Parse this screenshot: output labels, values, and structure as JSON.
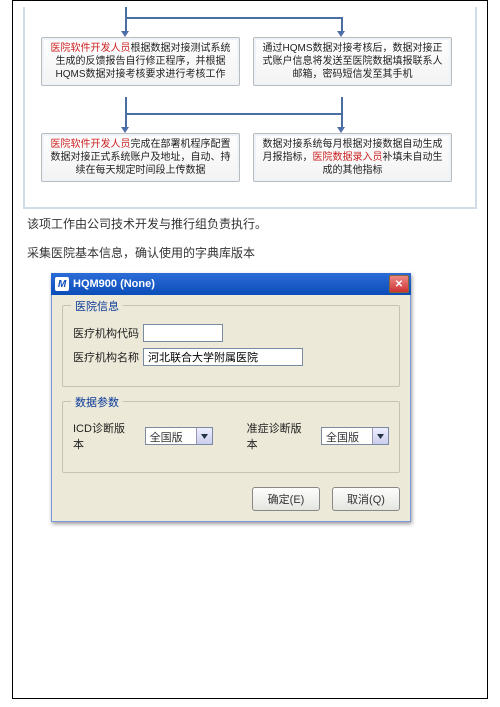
{
  "flow": {
    "box_top_left": {
      "hl": "医院软件开发人员",
      "rest": "根据数据对接测试系统生成的反馈报告自行修正程序，并根据HQMS数据对接考核要求进行考核工作"
    },
    "box_top_right": "通过HQMS数据对接考核后，数据对接正式账户信息将发送至医院数据填报联系人邮箱，密码短信发至其手机",
    "box_bot_left": {
      "hl": "医院软件开发人员",
      "rest": "完成在部署机程序配置数据对接正式系统账户及地址，自动、持续在每天规定时间段上传数据"
    },
    "box_bot_right": {
      "pre": "数据对接系统每月根据对接数据自动生成月报指标，",
      "hl": "医院数据录入员",
      "rest": "补填未自动生成的其他指标"
    }
  },
  "paragraph1": "该项工作由公司技术开发与推行组负责执行。",
  "paragraph2": "采集医院基本信息，确认使用的字典库版本",
  "dialog": {
    "title": "HQM900 (None)",
    "group1_title": "医院信息",
    "org_code_label": "医疗机构代码",
    "org_code_value": "",
    "org_name_label": "医疗机构名称",
    "org_name_value": "河北联合大学附属医院",
    "group2_title": "数据参数",
    "icd_label": "ICD诊断版本",
    "icd_value": "全国版",
    "tcm_label": "准症诊断版本",
    "tcm_value": "全国版",
    "ok_label": "确定(E)",
    "cancel_label": "取消(Q)"
  }
}
